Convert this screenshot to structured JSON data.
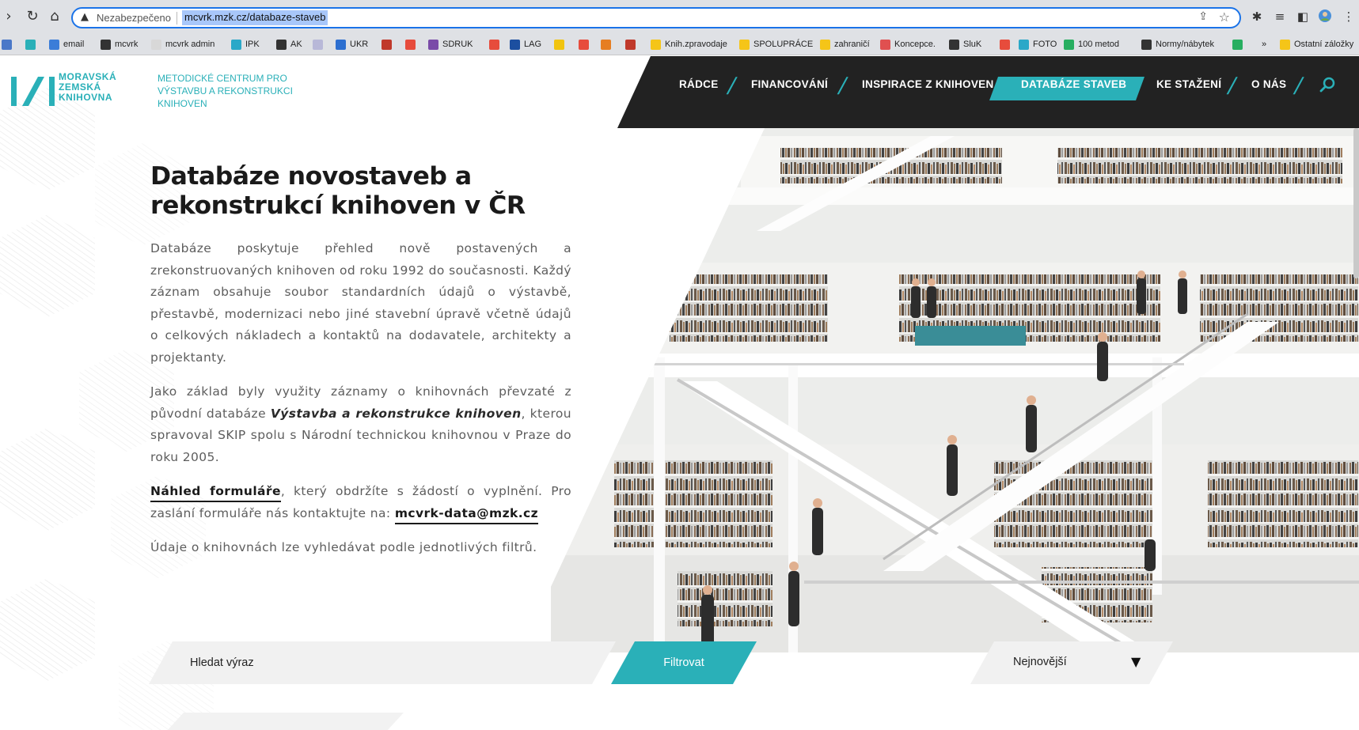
{
  "browser": {
    "security_label": "Nezabezpečeno",
    "url": "mcvrk.mzk.cz/databaze-staveb",
    "icons": [
      "back-icon",
      "reload-icon",
      "home-icon",
      "warning-icon",
      "share-icon",
      "star-icon",
      "extensions-icon",
      "reading-list-icon",
      "side-panel-icon",
      "profile-icon",
      "menu-icon"
    ],
    "bookmarks": [
      {
        "label": "",
        "color": "#4a78c8"
      },
      {
        "label": "",
        "color": "#2ab0b8"
      },
      {
        "label": "email",
        "color": "#3b7dd8"
      },
      {
        "label": "mcvrk",
        "color": "#333333"
      },
      {
        "label": "mcvrk admin",
        "color": "#d8d8d8"
      },
      {
        "label": "IPK",
        "color": "#2aa8c8"
      },
      {
        "label": "AK",
        "color": "#333333"
      },
      {
        "label": "",
        "color": "#b8b8d8"
      },
      {
        "label": "UKR",
        "color": "#2d6fd0"
      },
      {
        "label": "",
        "color": "#c0392b"
      },
      {
        "label": "",
        "color": "#e74c3c"
      },
      {
        "label": "SDRUK",
        "color": "#7a4ba8"
      },
      {
        "label": "",
        "color": "#e74c3c"
      },
      {
        "label": "LAG",
        "color": "#1c4fa0"
      },
      {
        "label": "",
        "color": "#f1c40f"
      },
      {
        "label": "",
        "color": "#e74c3c"
      },
      {
        "label": "",
        "color": "#e67e22"
      },
      {
        "label": "",
        "color": "#c0392b"
      },
      {
        "label": "Knih.zpravodaje",
        "color": "#f5c518"
      },
      {
        "label": "SPOLUPRÁCE",
        "color": "#f5c518"
      },
      {
        "label": "zahraničí",
        "color": "#f5c518"
      },
      {
        "label": "Koncepce.",
        "color": "#e05050"
      },
      {
        "label": "SluK",
        "color": "#333333"
      },
      {
        "label": "",
        "color": "#e74c3c"
      },
      {
        "label": "FOTO",
        "color": "#2aa8c8"
      },
      {
        "label": "100 metod",
        "color": "#27ae60"
      },
      {
        "label": "Normy/nábytek",
        "color": "#333333"
      },
      {
        "label": "",
        "color": "#27ae60"
      },
      {
        "label": "»",
        "color": ""
      },
      {
        "label": "Ostatní záložky",
        "color": "#f5c518"
      }
    ]
  },
  "brand": {
    "logo_lines": [
      "MORAVSKÁ",
      "ZEMSKÁ",
      "KNIHOVNA"
    ],
    "tagline_lines": [
      "METODICKÉ CENTRUM PRO",
      "VÝSTAVBU A REKONSTRUKCI",
      "KNIHOVEN"
    ],
    "accent": "#2ab0b8",
    "dark": "#222222"
  },
  "nav": {
    "items": [
      "RÁDCE",
      "FINANCOVÁNÍ",
      "INSPIRACE Z KNIHOVEN",
      "DATABÁZE STAVEB",
      "KE STAŽENÍ",
      "O NÁS"
    ],
    "active_index": 3
  },
  "main": {
    "title": "Databáze novostaveb a rekonstrukcí knihoven v ČR",
    "p1": "Databáze poskytuje přehled nově postavených a zrekonstruovaných knihoven od roku 1992 do současnosti. Každý záznam obsahuje soubor standardních údajů o výstavbě, přestavbě, modernizaci nebo jiné stavební úpravě včetně údajů o celkových nákladech a kontaktů na dodavatele, architekty a projektanty.",
    "p2_start": "Jako základ byly využity záznamy o knihovnách převzaté z původní databáze ",
    "p2_bold": "Výstavba a rekonstrukce knihoven",
    "p2_end": ", kterou spravoval SKIP spolu s Národní technickou knihovnou v Praze do roku 2005.",
    "p3_link": "Náhled formuláře",
    "p3_middle": ", který obdržíte s žádostí o vyplnění. Pro zaslání formuláře nás kontaktujte na: ",
    "p3_email": "mcvrk-data@mzk.cz",
    "p4": "Údaje o knihovnách lze vyhledávat podle jednotlivých filtrů."
  },
  "filters": {
    "search_placeholder": "Hledat výraz",
    "filter_button": "Filtrovat",
    "sort_selected": "Nejnovější"
  }
}
